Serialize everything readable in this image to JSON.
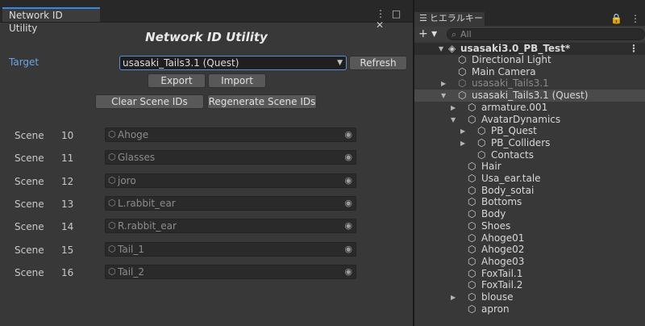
{
  "left": {
    "tab_title": "Network ID Utility",
    "tab_icons": [
      "⋮",
      "□",
      "✕"
    ],
    "heading": "Network ID Utility",
    "target_label": "Target",
    "target_value": "usasaki_Tails3.1 (Quest)",
    "buttons": {
      "refresh": "Refresh",
      "export": "Export",
      "import": "Import",
      "clear": "Clear Scene IDs",
      "regenerate": "Regenerate Scene IDs"
    },
    "rows": [
      {
        "label": "Scene",
        "id": "10",
        "object": "Ahoge"
      },
      {
        "label": "Scene",
        "id": "11",
        "object": "Glasses"
      },
      {
        "label": "Scene",
        "id": "12",
        "object": "joro"
      },
      {
        "label": "Scene",
        "id": "13",
        "object": "L.rabbit_ear"
      },
      {
        "label": "Scene",
        "id": "14",
        "object": "R.rabbit_ear"
      },
      {
        "label": "Scene",
        "id": "15",
        "object": "Tail_1"
      },
      {
        "label": "Scene",
        "id": "16",
        "object": "Tail_2"
      }
    ]
  },
  "hierarchy": {
    "tab_title": "ヒエラルキー",
    "tab_icons": [
      "🔒",
      "⋮"
    ],
    "add_label": "+ ▾",
    "search_placeholder": "All",
    "scene_name": "usasaki3.0_PB_Test*",
    "items": [
      {
        "text": "Directional Light",
        "depth": 1,
        "arrow": "",
        "dim": false,
        "sel": false
      },
      {
        "text": "Main Camera",
        "depth": 1,
        "arrow": "",
        "dim": false,
        "sel": false
      },
      {
        "text": "usasaki_Tails3.1",
        "depth": 1,
        "arrow": "▶",
        "dim": true,
        "sel": false
      },
      {
        "text": "usasaki_Tails3.1 (Quest)",
        "depth": 1,
        "arrow": "▼",
        "dim": false,
        "sel": true
      },
      {
        "text": "armature.001",
        "depth": 2,
        "arrow": "▶",
        "dim": false,
        "sel": false
      },
      {
        "text": "AvatarDynamics",
        "depth": 2,
        "arrow": "▼",
        "dim": false,
        "sel": false
      },
      {
        "text": "PB_Quest",
        "depth": 3,
        "arrow": "▶",
        "dim": false,
        "sel": false
      },
      {
        "text": "PB_Colliders",
        "depth": 3,
        "arrow": "▶",
        "dim": false,
        "sel": false
      },
      {
        "text": "Contacts",
        "depth": 3,
        "arrow": "",
        "dim": false,
        "sel": false
      },
      {
        "text": "Hair",
        "depth": 2,
        "arrow": "",
        "dim": false,
        "sel": false
      },
      {
        "text": "Usa_ear.tale",
        "depth": 2,
        "arrow": "",
        "dim": false,
        "sel": false
      },
      {
        "text": "Body_sotai",
        "depth": 2,
        "arrow": "",
        "dim": false,
        "sel": false
      },
      {
        "text": "Bottoms",
        "depth": 2,
        "arrow": "",
        "dim": false,
        "sel": false
      },
      {
        "text": "Body",
        "depth": 2,
        "arrow": "",
        "dim": false,
        "sel": false
      },
      {
        "text": "Shoes",
        "depth": 2,
        "arrow": "",
        "dim": false,
        "sel": false
      },
      {
        "text": "Ahoge01",
        "depth": 2,
        "arrow": "",
        "dim": false,
        "sel": false
      },
      {
        "text": "Ahoge02",
        "depth": 2,
        "arrow": "",
        "dim": false,
        "sel": false
      },
      {
        "text": "Ahoge03",
        "depth": 2,
        "arrow": "",
        "dim": false,
        "sel": false
      },
      {
        "text": "FoxTail.1",
        "depth": 2,
        "arrow": "",
        "dim": false,
        "sel": false
      },
      {
        "text": "FoxTail.2",
        "depth": 2,
        "arrow": "",
        "dim": false,
        "sel": false
      },
      {
        "text": "blouse",
        "depth": 2,
        "arrow": "▶",
        "dim": false,
        "sel": false
      },
      {
        "text": "apron",
        "depth": 2,
        "arrow": "",
        "dim": false,
        "sel": false
      }
    ]
  },
  "colors": {
    "accent": "#3b86d9",
    "panel": "#383838",
    "selection": "#4a4a4a"
  },
  "icons": {
    "object": "cube-icon",
    "pick": "object-picker-icon",
    "search": "search-icon"
  }
}
